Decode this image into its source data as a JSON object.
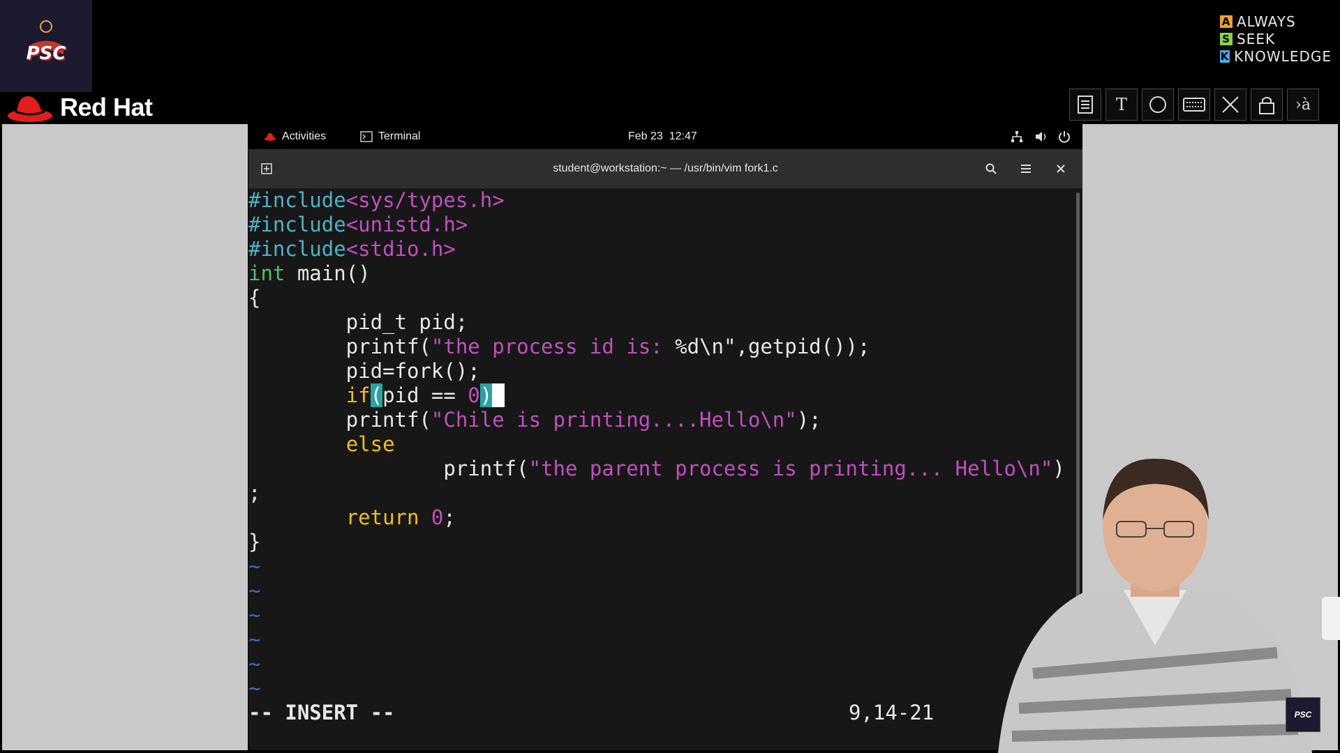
{
  "branding": {
    "psc_logo_text": "PSC",
    "redhat_text": "Red Hat",
    "ask": [
      {
        "letter": "A",
        "word": "ALWAYS",
        "color": "#f0a030"
      },
      {
        "letter": "S",
        "word": "SEEK",
        "color": "#8bd14a"
      },
      {
        "letter": "K",
        "word": "KNOWLEDGE",
        "color": "#4aa8e0"
      }
    ]
  },
  "toolbar_icons": [
    "document-icon",
    "text-tool-icon",
    "circle-tool-icon",
    "keyboard-icon",
    "cut-icon",
    "lock-icon",
    "translate-icon"
  ],
  "gnome": {
    "activities": "Activities",
    "app_name": "Terminal",
    "clock": "Feb 23  12:47"
  },
  "terminal": {
    "title": "student@workstation:~ — /usr/bin/vim fork1.c"
  },
  "vim": {
    "include1_directive": "#include",
    "include1_header": "<sys/types.h>",
    "include2_directive": "#include",
    "include2_header": "<unistd.h>",
    "include3_directive": "#include",
    "include3_header": "<stdio.h>",
    "main_type": "int",
    "main_rest": " main()",
    "open_brace": "{",
    "pid_decl": "        pid_t pid;",
    "printf1_fn": "        printf(",
    "printf1_str": "\"the process id is: ",
    "printf1_fmt": "%d\\n\"",
    "printf1_tail": ",getpid());",
    "fork_line": "        pid=fork();",
    "if_indent": "        ",
    "if_kw": "if",
    "if_open": "(",
    "if_cond": "pid == ",
    "if_zero": "0",
    "if_close": ")",
    "printf2_fn": "        printf(",
    "printf2_str": "\"Chile is printing....Hello\\n\"",
    "printf2_tail": ");",
    "else_indent": "        ",
    "else_kw": "else",
    "printf3_fn": "                printf(",
    "printf3_str": "\"the parent process is printing... Hello\\n\"",
    "printf3_tail": ")",
    "semicolon": ";",
    "return_indent": "        ",
    "return_kw": "return",
    "return_val": "0",
    "return_semi": ";",
    "close_brace": "}",
    "tilde": "~",
    "mode": "-- INSERT --",
    "position": "9,14-21"
  }
}
